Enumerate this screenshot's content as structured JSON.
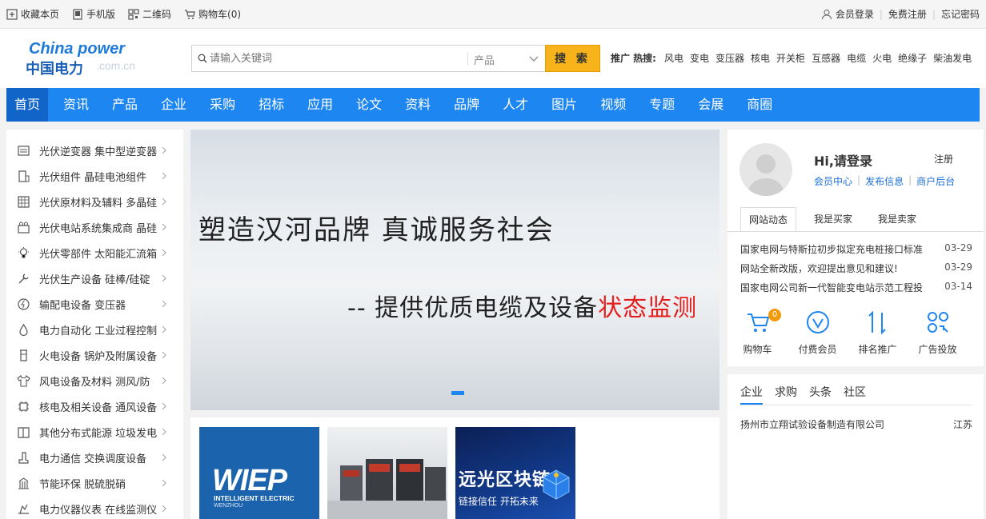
{
  "topbar": {
    "left": [
      {
        "icon": "bookmark-icon",
        "label": "收藏本页"
      },
      {
        "icon": "mobile-icon",
        "label": "手机版"
      },
      {
        "icon": "qrcode-icon",
        "label": "二维码"
      },
      {
        "icon": "cart-icon",
        "label": "购物车(0)"
      }
    ],
    "right": {
      "login": "会员登录",
      "register": "免费注册",
      "forgot": "忘记密码"
    }
  },
  "logo": {
    "en": "China power",
    "cn": "中国电力",
    "domain": ".com.cn"
  },
  "search": {
    "placeholder": "请输入关键词",
    "category": "产品",
    "button": "搜 索"
  },
  "hot": {
    "label": "推广 热搜:",
    "terms": [
      "风电",
      "变电",
      "变压器",
      "核电",
      "开关柜",
      "互感器",
      "电缆",
      "火电",
      "绝缘子",
      "柴油发电"
    ]
  },
  "nav": [
    "首页",
    "资讯",
    "产品",
    "企业",
    "采购",
    "招标",
    "应用",
    "论文",
    "资料",
    "品牌",
    "人才",
    "图片",
    "视频",
    "专题",
    "会展",
    "商圈"
  ],
  "sidebar": [
    {
      "icon": "inverter-icon",
      "label": "光伏逆变器 集中型逆变器"
    },
    {
      "icon": "solar-module-icon",
      "label": "光伏组件 晶硅电池组件"
    },
    {
      "icon": "grid-material-icon",
      "label": "光伏原材料及辅料 多晶硅"
    },
    {
      "icon": "power-station-icon",
      "label": "光伏电站系统集成商 晶硅"
    },
    {
      "icon": "bulb-icon",
      "label": "光伏零部件 太阳能汇流箱"
    },
    {
      "icon": "tools-icon",
      "label": "光伏生产设备 硅棒/硅碇"
    },
    {
      "icon": "lightning-icon",
      "label": "输配电设备 变压器"
    },
    {
      "icon": "drop-icon",
      "label": "电力自动化 工业过程控制"
    },
    {
      "icon": "boiler-icon",
      "label": "火电设备 锅炉及附属设备"
    },
    {
      "icon": "shirt-icon",
      "label": "风电设备及材料 测风/防"
    },
    {
      "icon": "chip-icon",
      "label": "核电及相关设备 通风设备"
    },
    {
      "icon": "book-icon",
      "label": "其他分布式能源 垃圾发电"
    },
    {
      "icon": "boot-icon",
      "label": "电力通信 交换调度设备"
    },
    {
      "icon": "building-icon",
      "label": "节能环保 脱硫脱硝"
    },
    {
      "icon": "instrument-icon",
      "label": "电力仪器仪表 在线监测仪"
    }
  ],
  "banner": {
    "line1": "塑造汉河品牌  真诚服务社会",
    "line2_prefix": "-- 提供优质电缆及设备",
    "line2_highlight": "状态监测"
  },
  "thumbs": [
    {
      "big": "WIEP",
      "small": "INTELLIGENT ELECTRIC",
      "small2": "WENZHOU"
    },
    {},
    {
      "big": "远光区块链",
      "small": "链接信任  开拓未来"
    }
  ],
  "user": {
    "hi": "Hi,请登录",
    "register": "注册",
    "links": [
      "会员中心",
      "发布信息",
      "商户后台"
    ]
  },
  "panel_tabs": [
    "网站动态",
    "我是买家",
    "我是卖家"
  ],
  "news": [
    {
      "title": "国家电网与特斯拉初步拟定充电桩接口标准",
      "date": "03-29"
    },
    {
      "title": "网站全新改版，欢迎提出意见和建议!",
      "date": "03-29"
    },
    {
      "title": "国家电网公司新一代智能变电站示范工程投",
      "date": "03-14"
    }
  ],
  "quick": [
    {
      "icon": "cart-icon",
      "label": "购物车",
      "badge": "0"
    },
    {
      "icon": "vip-icon",
      "label": "付费会员"
    },
    {
      "icon": "rank-icon",
      "label": "排名推广"
    },
    {
      "icon": "ad-icon",
      "label": "广告投放"
    }
  ],
  "company_tabs": [
    "企业",
    "求购",
    "头条",
    "社区"
  ],
  "company": {
    "name": "扬州市立翔试验设备制造有限公司",
    "region": "江苏"
  },
  "colors": {
    "nav_blue": "#1e86f0",
    "nav_active": "#1265c8",
    "search_button": "#f9b31a",
    "banner_highlight": "#e41d1d"
  }
}
